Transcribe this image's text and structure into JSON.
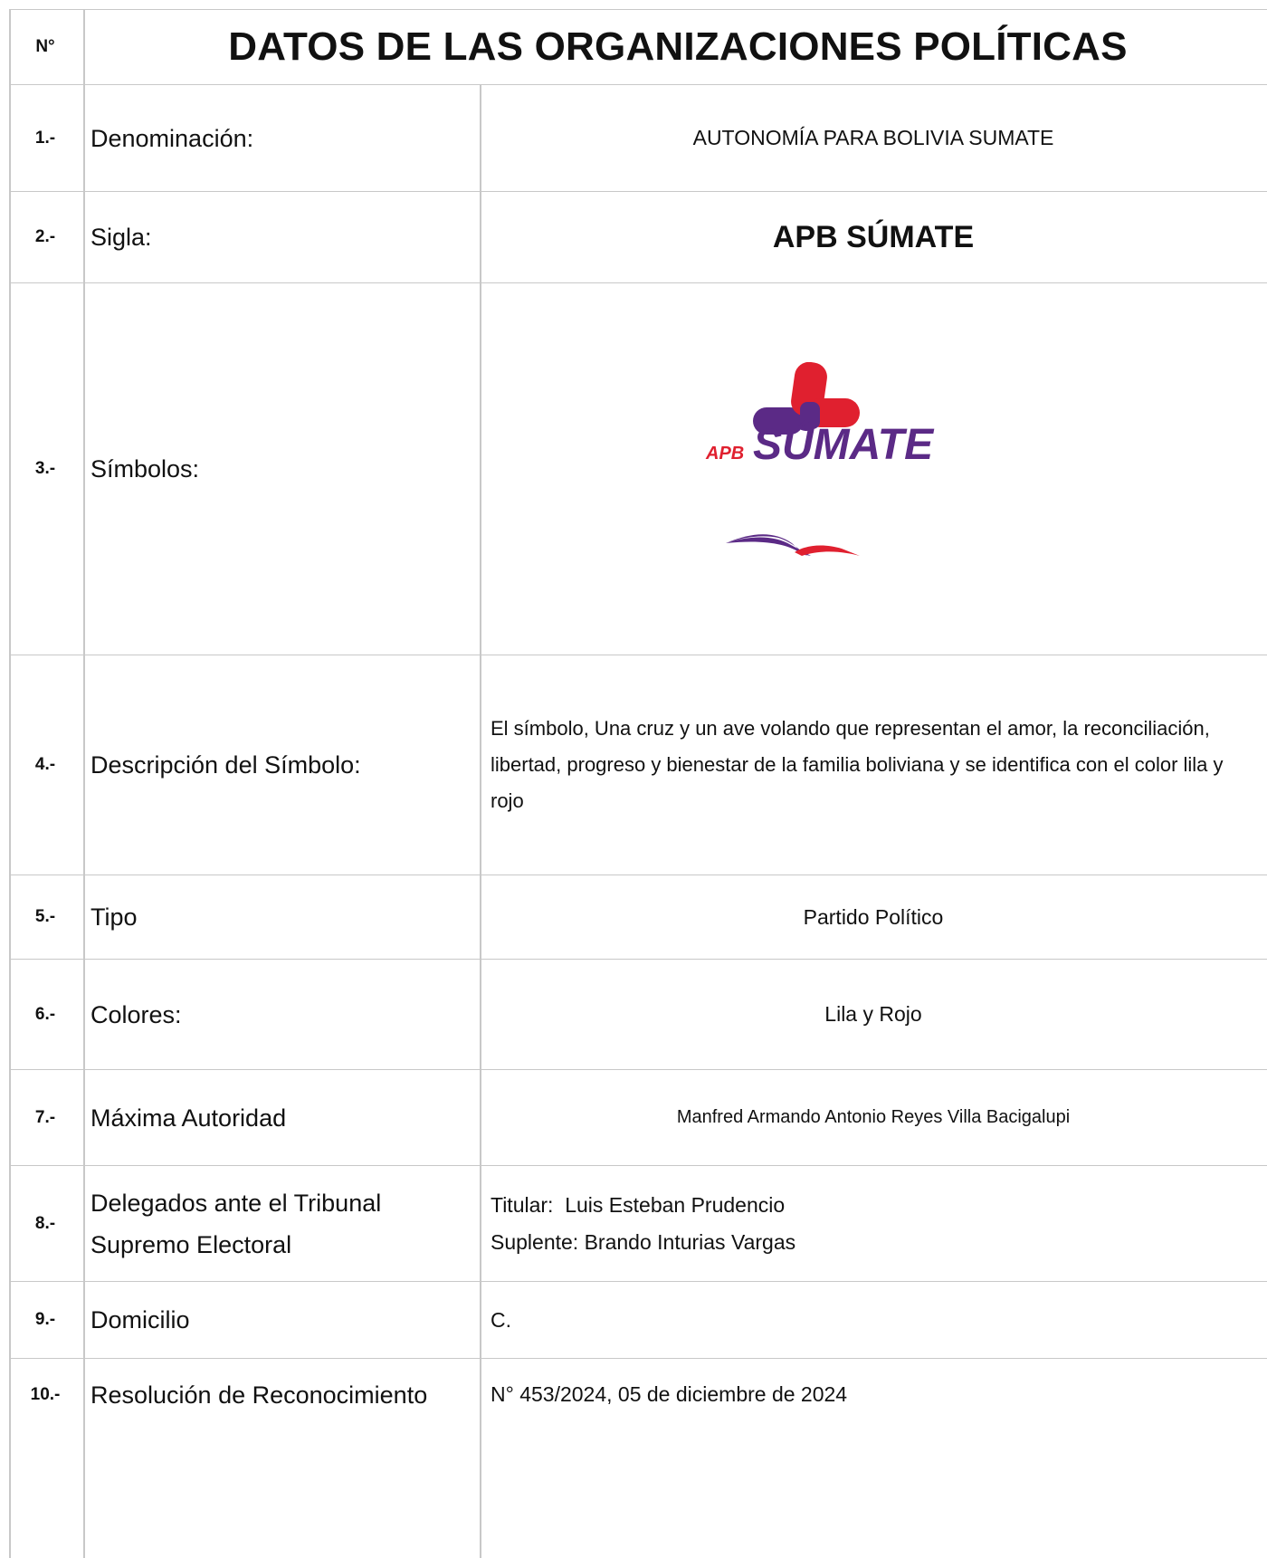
{
  "header": {
    "num_label": "N°",
    "title": "DATOS DE LAS ORGANIZACIONES POLÍTICAS"
  },
  "rows": [
    {
      "num": "1.-",
      "label": "Denominación:",
      "value": "AUTONOMÍA PARA BOLIVIA SUMATE"
    },
    {
      "num": "2.-",
      "label": "Sigla:",
      "value": "APB SÚMATE"
    },
    {
      "num": "3.-",
      "label": "Símbolos:"
    },
    {
      "num": "4.-",
      "label": "Descripción del Símbolo:",
      "value": "El símbolo, Una cruz y un ave volando que representan el amor, la reconcilia­ción, libertad, progreso y bienestar de la familia boliviana y se identifica con el color lila y rojo"
    },
    {
      "num": "5.-",
      "label": "Tipo",
      "value": "Partido Político"
    },
    {
      "num": "6.-",
      "label": "Colores:",
      "value": "Lila y Rojo"
    },
    {
      "num": "7.-",
      "label": "Máxima Autoridad",
      "value": "Manfred Armando Antonio Reyes Villa Bacigalupi"
    },
    {
      "num": "8.-",
      "label": "Delegados ante el Tribunal Supremo Electoral",
      "value_titular": "Titular:  Luis Esteban Prudencio",
      "value_suplente": "Suplente: Brando Inturias Vargas"
    },
    {
      "num": "9.-",
      "label": "Domicilio",
      "value": "C."
    },
    {
      "num": "10.-",
      "label": "Resolución de Reconocimiento",
      "value": "N° 453/2024, 05 de diciembre de 2024"
    }
  ],
  "logo": {
    "prefix": "APB",
    "name": "SÚMATE",
    "colors": {
      "lila": "#5b2a86",
      "rojo": "#e0202f"
    },
    "icons": [
      "cross-icon",
      "bird-icon"
    ]
  }
}
